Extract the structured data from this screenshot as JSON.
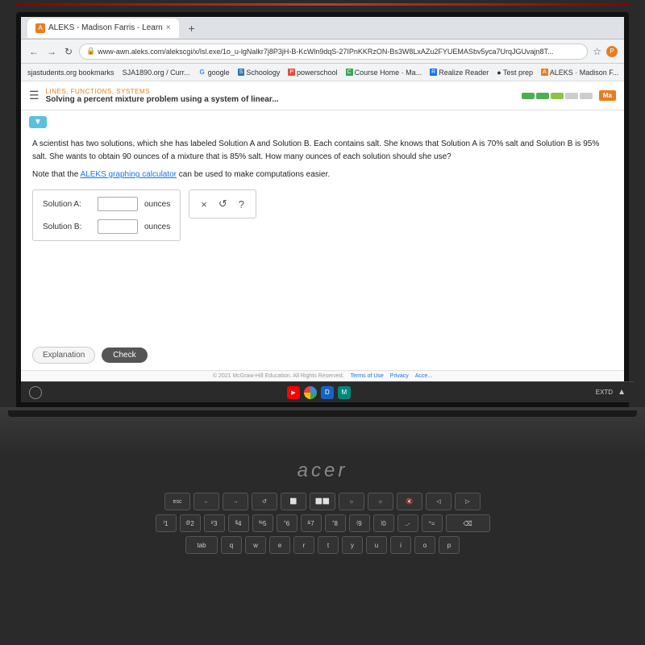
{
  "browser": {
    "tab_label": "ALEKS - Madison Farris - Learn",
    "url": "www-awn.aleks.com/alekscgi/x/lsl.exe/1o_u-lgNalkr7j8P3jH-B-KcWln9dqS-27IPnKKRzON-Bs3W8LxAZu2FYUEMASbv5yca7UrqJGUvajn8T...",
    "new_tab_label": "+",
    "bookmarks": [
      {
        "label": "sjastudents.org bookmarks"
      },
      {
        "label": "SJA1890.org / Curr..."
      },
      {
        "label": "google"
      },
      {
        "label": "Schoology"
      },
      {
        "label": "powerschool"
      },
      {
        "label": "Course Home · Ma..."
      },
      {
        "label": "Realize Reader"
      },
      {
        "label": "Test prep"
      },
      {
        "label": "ALEKS · Madison F..."
      }
    ]
  },
  "aleks": {
    "breadcrumb": "LINES, FUNCTIONS, SYSTEMS",
    "title": "Solving a percent mixture problem using a system of linear...",
    "progress_label": "Ma",
    "problem_text": "A scientist has two solutions, which she has labeled Solution A and Solution B. Each contains salt. She knows that Solution A is 70% salt and Solution B is 95% salt. She wants to obtain 90 ounces of a mixture that is 85% salt. How many ounces of each solution should she use?",
    "note_text": "Note that the ALEKS graphing calculator can be used to make computations easier.",
    "calculator_link": "ALEKS graphing calculator",
    "solution_a_label": "Solution A:",
    "solution_b_label": "Solution B:",
    "ounces_label_a": "ounces",
    "ounces_label_b": "ounces",
    "input_a_value": "",
    "input_b_value": "",
    "btn_explanation": "Explanation",
    "btn_check": "Check",
    "action_x": "×",
    "action_undo": "↺",
    "action_help": "?",
    "footer_copyright": "© 2021 McGraw-Hill Education. All Rights Reserved.",
    "footer_terms": "Terms of Use",
    "footer_privacy": "Privacy",
    "footer_access": "Acce..."
  },
  "taskbar": {
    "extd_label": "EXTD",
    "wifi_label": "▲"
  },
  "keyboard": {
    "row1": [
      "esc",
      "←",
      "→",
      "↺",
      "⬜",
      "⬜⬜",
      "○",
      "☼",
      "☼",
      "◁",
      "▷"
    ],
    "row2": [
      "!",
      "@",
      "#",
      "$",
      "%",
      "^",
      "&",
      "*",
      "(",
      ")",
      "—",
      "+"
    ],
    "row2b": [
      "1",
      "2",
      "3",
      "4",
      "5",
      "6",
      "7",
      "8",
      "9",
      "0",
      "-",
      "="
    ],
    "row3": [
      "q",
      "w",
      "e",
      "r",
      "t",
      "y",
      "u",
      "i",
      "o",
      "p"
    ],
    "acer_logo": "acer"
  }
}
